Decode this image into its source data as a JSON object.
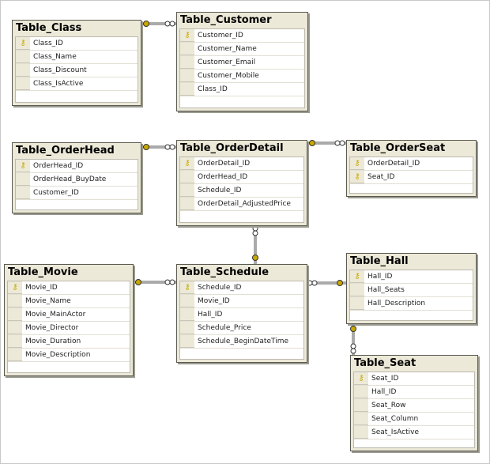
{
  "tables": [
    {
      "name": "Table_Class",
      "columns": [
        {
          "name": "Class_ID",
          "pk": true
        },
        {
          "name": "Class_Name",
          "pk": false
        },
        {
          "name": "Class_Discount",
          "pk": false
        },
        {
          "name": "Class_IsActive",
          "pk": false
        }
      ]
    },
    {
      "name": "Table_Customer",
      "columns": [
        {
          "name": "Customer_ID",
          "pk": true
        },
        {
          "name": "Customer_Name",
          "pk": false
        },
        {
          "name": "Customer_Email",
          "pk": false
        },
        {
          "name": "Customer_Mobile",
          "pk": false
        },
        {
          "name": "Class_ID",
          "pk": false
        }
      ]
    },
    {
      "name": "Table_OrderHead",
      "columns": [
        {
          "name": "OrderHead_ID",
          "pk": true
        },
        {
          "name": "OrderHead_BuyDate",
          "pk": false
        },
        {
          "name": "Customer_ID",
          "pk": false
        }
      ]
    },
    {
      "name": "Table_OrderDetail",
      "columns": [
        {
          "name": "OrderDetail_ID",
          "pk": true
        },
        {
          "name": "OrderHead_ID",
          "pk": false
        },
        {
          "name": "Schedule_ID",
          "pk": false
        },
        {
          "name": "OrderDetail_AdjustedPrice",
          "pk": false
        }
      ]
    },
    {
      "name": "Table_OrderSeat",
      "columns": [
        {
          "name": "OrderDetail_ID",
          "pk": true
        },
        {
          "name": "Seat_ID",
          "pk": true
        }
      ]
    },
    {
      "name": "Table_Movie",
      "columns": [
        {
          "name": "Movie_ID",
          "pk": true
        },
        {
          "name": "Movie_Name",
          "pk": false
        },
        {
          "name": "Movie_MainActor",
          "pk": false
        },
        {
          "name": "Movie_Director",
          "pk": false
        },
        {
          "name": "Movie_Duration",
          "pk": false
        },
        {
          "name": "Movie_Description",
          "pk": false
        }
      ]
    },
    {
      "name": "Table_Schedule",
      "columns": [
        {
          "name": "Schedule_ID",
          "pk": true
        },
        {
          "name": "Movie_ID",
          "pk": false
        },
        {
          "name": "Hall_ID",
          "pk": false
        },
        {
          "name": "Schedule_Price",
          "pk": false
        },
        {
          "name": "Schedule_BeginDateTime",
          "pk": false
        }
      ]
    },
    {
      "name": "Table_Hall",
      "columns": [
        {
          "name": "Hall_ID",
          "pk": true
        },
        {
          "name": "Hall_Seats",
          "pk": false
        },
        {
          "name": "Hall_Description",
          "pk": false
        }
      ]
    },
    {
      "name": "Table_Seat",
      "columns": [
        {
          "name": "Seat_ID",
          "pk": true
        },
        {
          "name": "Hall_ID",
          "pk": false
        },
        {
          "name": "Seat_Row",
          "pk": false
        },
        {
          "name": "Seat_Column",
          "pk": false
        },
        {
          "name": "Seat_IsActive",
          "pk": false
        }
      ]
    }
  ],
  "relationships": [
    {
      "one": "Table_Class",
      "many": "Table_Customer"
    },
    {
      "one": "Table_OrderHead",
      "many": "Table_OrderDetail"
    },
    {
      "one": "Table_OrderDetail",
      "many": "Table_OrderSeat"
    },
    {
      "one": "Table_Schedule",
      "many": "Table_OrderDetail"
    },
    {
      "one": "Table_Movie",
      "many": "Table_Schedule"
    },
    {
      "one": "Table_Hall",
      "many": "Table_Schedule"
    },
    {
      "one": "Table_Hall",
      "many": "Table_Seat"
    }
  ],
  "colors": {
    "header": "#ece9d8",
    "key": "#c8a800",
    "border": "#5a5a52"
  }
}
